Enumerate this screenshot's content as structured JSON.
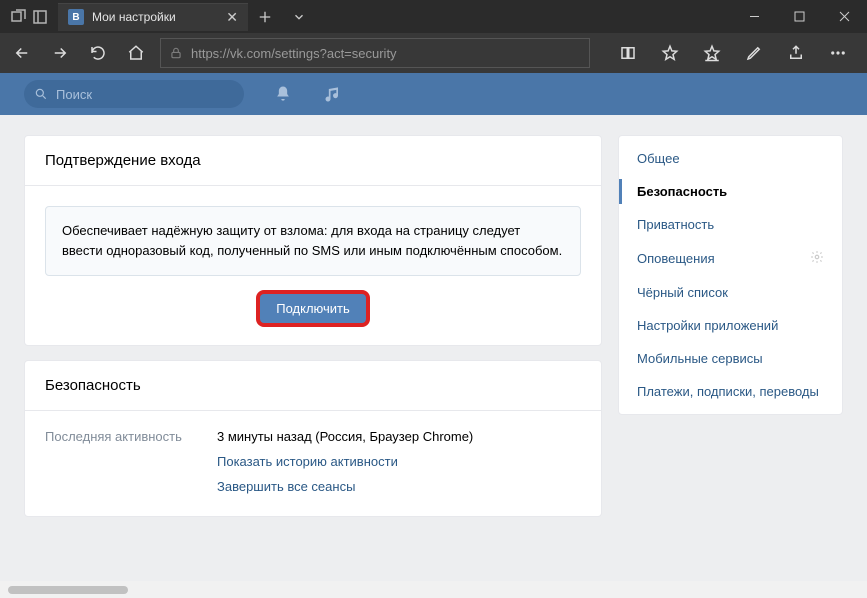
{
  "browser": {
    "tab_title": "Мои настройки",
    "url": "https://vk.com/settings?act=security"
  },
  "vk_header": {
    "search_placeholder": "Поиск"
  },
  "card1": {
    "title": "Подтверждение входа",
    "info_text": "Обеспечивает надёжную защиту от взлома: для входа на страницу следует ввести одноразовый код, полученный по SMS или иным подключённым способом.",
    "enable_label": "Подключить"
  },
  "card2": {
    "title": "Безопасность",
    "activity_label": "Последняя активность",
    "activity_value": "3 минуты назад (Россия, Браузер Chrome)",
    "activity_history_link": "Показать историю активности",
    "activity_end_sessions_link": "Завершить все сеансы"
  },
  "sidebar": {
    "items": [
      "Общее",
      "Безопасность",
      "Приватность",
      "Оповещения",
      "Чёрный список",
      "Настройки приложений",
      "Мобильные сервисы",
      "Платежи, подписки, переводы"
    ]
  }
}
